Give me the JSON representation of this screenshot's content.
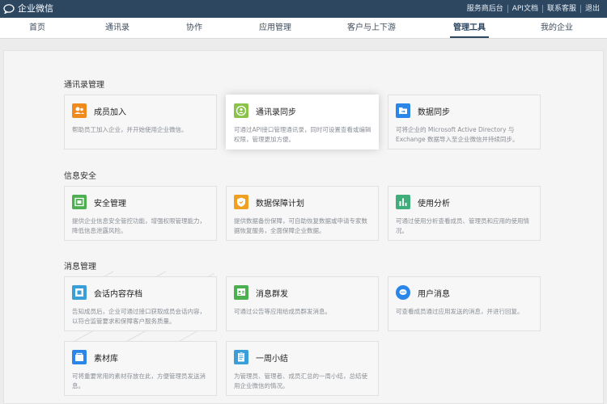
{
  "topbar": {
    "title": "企业微信",
    "links": [
      "服务商后台",
      "API文档",
      "联系客服",
      "退出"
    ]
  },
  "nav": {
    "items": [
      "首页",
      "通讯录",
      "协作",
      "应用管理",
      "客户与上下游",
      "管理工具",
      "我的企业"
    ],
    "active_index": 5
  },
  "sections": [
    {
      "title": "通讯录管理",
      "cards": [
        {
          "title": "成员加入",
          "desc": "帮助员工加入企业，并开始使用企业微信。",
          "color": "#f08a1c",
          "icon": "member-join-icon"
        },
        {
          "title": "通讯录同步",
          "desc": "可通过API接口管理通讯录，同时可设置查看或编辑权限，管理更加方便。",
          "color": "#8bc34a",
          "icon": "contacts-sync-icon",
          "highlighted": true
        },
        {
          "title": "数据同步",
          "desc": "可将企业的 Microsoft Active Directory 与 Exchange 数据导入至企业微信并持续同步。",
          "color": "#2a86e8",
          "icon": "data-sync-icon"
        }
      ]
    },
    {
      "title": "信息安全",
      "cards": [
        {
          "title": "安全管理",
          "desc": "提供企业信息安全管控功能，增强权限管理能力，降低信息泄露风险。",
          "color": "#4caf50",
          "icon": "security-icon"
        },
        {
          "title": "数据保障计划",
          "desc": "提供数据备份保障，可自助恢复数据或申请专家数据恢复服务，全面保障企业数据。",
          "color": "#f0a020",
          "icon": "data-shield-icon"
        },
        {
          "title": "使用分析",
          "desc": "可通过使用分析查看成员、管理员和应用的使用情况。",
          "color": "#3fae7b",
          "icon": "usage-chart-icon"
        }
      ]
    },
    {
      "title": "消息管理",
      "cards": [
        {
          "title": "会话内容存档",
          "desc": "告知成员后，企业可通过接口获取成员会话内容，以符合监管要求和保障客户服务质量。",
          "color": "#3a9ed8",
          "icon": "archive-icon"
        },
        {
          "title": "消息群发",
          "desc": "可通过公告等应用给成员群发消息。",
          "color": "#4caf50",
          "icon": "broadcast-icon"
        },
        {
          "title": "用户消息",
          "desc": "可查看成员通过应用发送的消息，并进行回复。",
          "color": "#2a86e8",
          "icon": "user-message-icon"
        },
        {
          "title": "素材库",
          "desc": "可将重要常用的素材存放在此，方便管理员发送消息。",
          "color": "#2a86e8",
          "icon": "material-library-icon"
        },
        {
          "title": "一周小结",
          "desc": "为管理员、管理者、成员汇总的一周小结，总结使用企业微信的情况。",
          "color": "#3a9ed8",
          "icon": "weekly-summary-icon"
        }
      ]
    }
  ]
}
